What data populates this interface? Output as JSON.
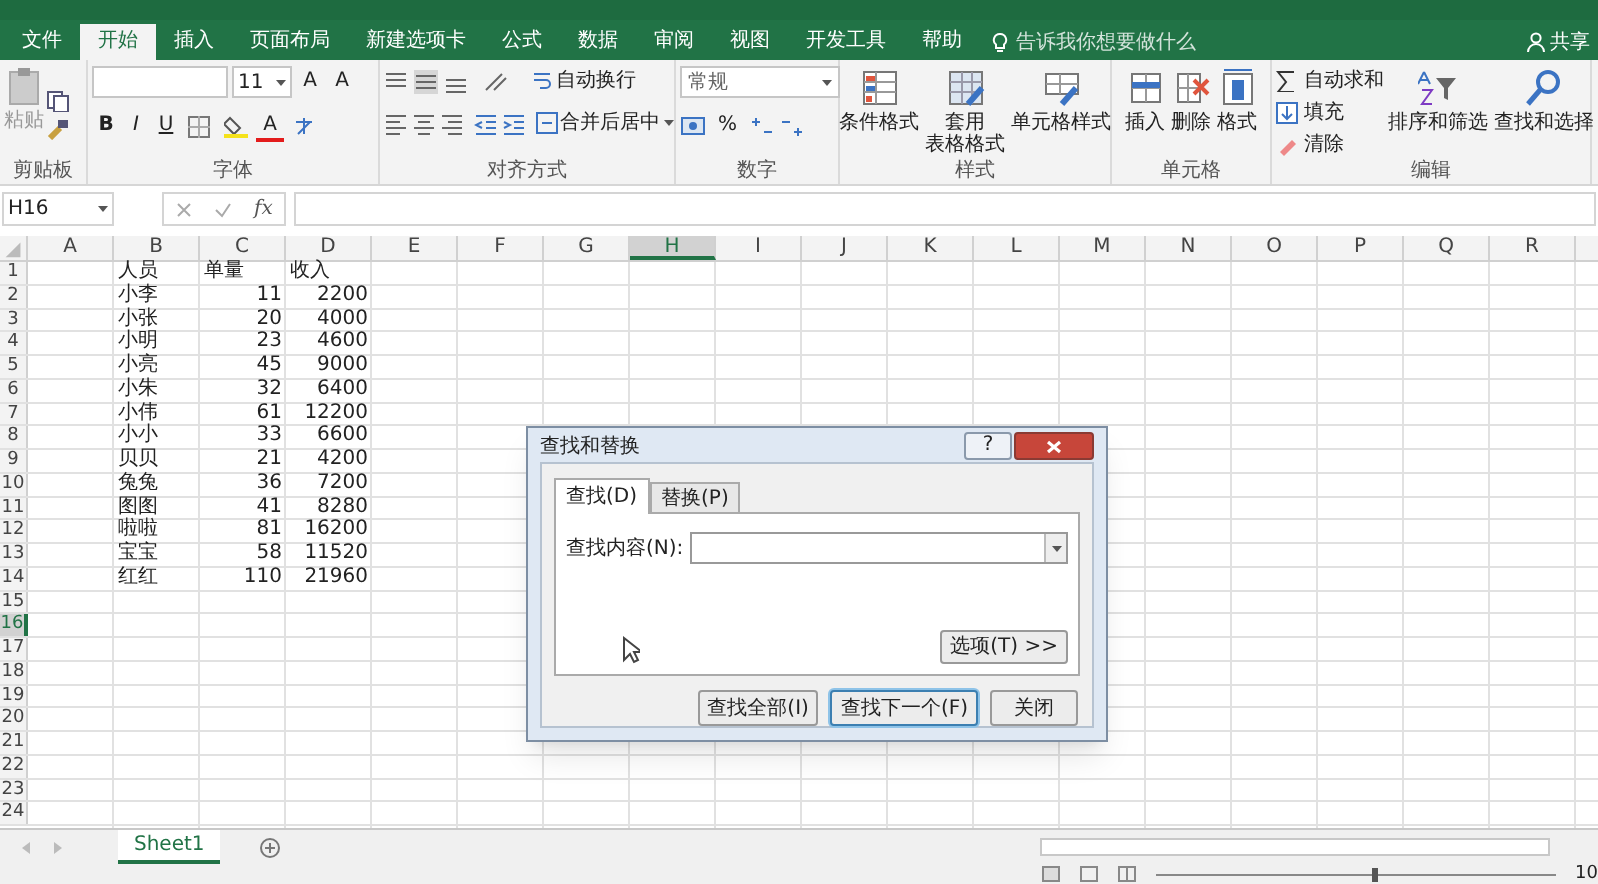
{
  "ribbon_tabs": [
    {
      "label": "文件",
      "selected": false
    },
    {
      "label": "开始",
      "selected": true
    },
    {
      "label": "插入",
      "selected": false
    },
    {
      "label": "页面布局",
      "selected": false
    },
    {
      "label": "新建选项卡",
      "selected": false
    },
    {
      "label": "公式",
      "selected": false
    },
    {
      "label": "数据",
      "selected": false
    },
    {
      "label": "审阅",
      "selected": false
    },
    {
      "label": "视图",
      "selected": false
    },
    {
      "label": "开发工具",
      "selected": false
    },
    {
      "label": "帮助",
      "selected": false
    }
  ],
  "tell_me": "告诉我你想要做什么",
  "share": "共享",
  "ribbon_groups": [
    {
      "kind": "clipboard",
      "label": "剪贴板",
      "paste": "粘贴"
    },
    {
      "kind": "font",
      "label": "字体",
      "font_size": "11",
      "grow": "A",
      "shrink": "A",
      "bold": "B",
      "italic": "I",
      "underline": "U",
      "font_color": "A"
    },
    {
      "kind": "alignment",
      "label": "对齐方式",
      "wrap_text": "自动换行",
      "merge": "合并后居中"
    },
    {
      "kind": "number",
      "label": "数字",
      "format": "常规",
      "percent": "%"
    },
    {
      "kind": "big_buttons",
      "label": "样式",
      "buttons": [
        [
          "条件格式"
        ],
        [
          "套用",
          "表格格式"
        ],
        [
          "单元格样式"
        ]
      ]
    },
    {
      "kind": "big_buttons",
      "label": "单元格",
      "buttons": [
        [
          "插入"
        ],
        [
          "删除"
        ],
        [
          "格式"
        ]
      ]
    },
    {
      "kind": "editing",
      "label": "编辑",
      "small": [
        "自动求和",
        "填充",
        "清除"
      ],
      "buttons": [
        "排序和筛选",
        "查找和选择"
      ]
    }
  ],
  "formula_bar": {
    "name_box": "H16",
    "function_label": "fx"
  },
  "sheet": {
    "columns": [
      {
        "label": "A",
        "selected": false
      },
      {
        "label": "B",
        "selected": false
      },
      {
        "label": "C",
        "selected": false
      },
      {
        "label": "D",
        "selected": false
      },
      {
        "label": "E",
        "selected": false
      },
      {
        "label": "F",
        "selected": false
      },
      {
        "label": "G",
        "selected": false
      },
      {
        "label": "H",
        "selected": true
      },
      {
        "label": "I",
        "selected": false
      },
      {
        "label": "J",
        "selected": false
      },
      {
        "label": "K",
        "selected": false
      },
      {
        "label": "L",
        "selected": false
      },
      {
        "label": "M",
        "selected": false
      },
      {
        "label": "N",
        "selected": false
      },
      {
        "label": "O",
        "selected": false
      },
      {
        "label": "P",
        "selected": false
      },
      {
        "label": "Q",
        "selected": false
      },
      {
        "label": "R",
        "selected": false
      }
    ],
    "rows": [
      {
        "number": "1",
        "selected": false,
        "cells": {
          "B": {
            "text": "人员",
            "kind": "text"
          },
          "C": {
            "text": "单量",
            "kind": "text"
          },
          "D": {
            "text": "收入",
            "kind": "text"
          }
        }
      },
      {
        "number": "2",
        "selected": false,
        "cells": {
          "B": {
            "text": "小李",
            "kind": "text"
          },
          "C": {
            "text": "11",
            "kind": "number"
          },
          "D": {
            "text": "2200",
            "kind": "number"
          }
        }
      },
      {
        "number": "3",
        "selected": false,
        "cells": {
          "B": {
            "text": "小张",
            "kind": "text"
          },
          "C": {
            "text": "20",
            "kind": "number"
          },
          "D": {
            "text": "4000",
            "kind": "number"
          }
        }
      },
      {
        "number": "4",
        "selected": false,
        "cells": {
          "B": {
            "text": "小明",
            "kind": "text"
          },
          "C": {
            "text": "23",
            "kind": "number"
          },
          "D": {
            "text": "4600",
            "kind": "number"
          }
        }
      },
      {
        "number": "5",
        "selected": false,
        "cells": {
          "B": {
            "text": "小亮",
            "kind": "text"
          },
          "C": {
            "text": "45",
            "kind": "number"
          },
          "D": {
            "text": "9000",
            "kind": "number"
          }
        }
      },
      {
        "number": "6",
        "selected": false,
        "cells": {
          "B": {
            "text": "小朱",
            "kind": "text"
          },
          "C": {
            "text": "32",
            "kind": "number"
          },
          "D": {
            "text": "6400",
            "kind": "number"
          }
        }
      },
      {
        "number": "7",
        "selected": false,
        "cells": {
          "B": {
            "text": "小伟",
            "kind": "text"
          },
          "C": {
            "text": "61",
            "kind": "number"
          },
          "D": {
            "text": "12200",
            "kind": "number"
          }
        }
      },
      {
        "number": "8",
        "selected": false,
        "cells": {
          "B": {
            "text": "小小",
            "kind": "text"
          },
          "C": {
            "text": "33",
            "kind": "number"
          },
          "D": {
            "text": "6600",
            "kind": "number"
          }
        }
      },
      {
        "number": "9",
        "selected": false,
        "cells": {
          "B": {
            "text": "贝贝",
            "kind": "text"
          },
          "C": {
            "text": "21",
            "kind": "number"
          },
          "D": {
            "text": "4200",
            "kind": "number"
          }
        }
      },
      {
        "number": "10",
        "selected": false,
        "cells": {
          "B": {
            "text": "兔兔",
            "kind": "text"
          },
          "C": {
            "text": "36",
            "kind": "number"
          },
          "D": {
            "text": "7200",
            "kind": "number"
          }
        }
      },
      {
        "number": "11",
        "selected": false,
        "cells": {
          "B": {
            "text": "图图",
            "kind": "text"
          },
          "C": {
            "text": "41",
            "kind": "number"
          },
          "D": {
            "text": "8280",
            "kind": "number"
          }
        }
      },
      {
        "number": "12",
        "selected": false,
        "cells": {
          "B": {
            "text": "啦啦",
            "kind": "text"
          },
          "C": {
            "text": "81",
            "kind": "number"
          },
          "D": {
            "text": "16200",
            "kind": "number"
          }
        }
      },
      {
        "number": "13",
        "selected": false,
        "cells": {
          "B": {
            "text": "宝宝",
            "kind": "text"
          },
          "C": {
            "text": "58",
            "kind": "number"
          },
          "D": {
            "text": "11520",
            "kind": "number"
          }
        }
      },
      {
        "number": "14",
        "selected": false,
        "cells": {
          "B": {
            "text": "红红",
            "kind": "text"
          },
          "C": {
            "text": "110",
            "kind": "number"
          },
          "D": {
            "text": "21960",
            "kind": "number"
          }
        }
      },
      {
        "number": "15",
        "selected": false
      },
      {
        "number": "16",
        "selected": true
      },
      {
        "number": "17",
        "selected": false
      },
      {
        "number": "18",
        "selected": false
      },
      {
        "number": "19",
        "selected": false
      },
      {
        "number": "20",
        "selected": false
      },
      {
        "number": "21",
        "selected": false
      },
      {
        "number": "22",
        "selected": false
      },
      {
        "number": "23",
        "selected": false
      },
      {
        "number": "24",
        "selected": false
      }
    ]
  },
  "sheet_tabs": [
    {
      "label": "Sheet1",
      "selected": true
    }
  ],
  "status_bar": {
    "zoom_slider": {
      "level": 0.55
    },
    "zoom": "10"
  },
  "dialog": {
    "title": "查找和替换",
    "help": "?",
    "tabs": [
      {
        "label": "查找(D)",
        "selected": true
      },
      {
        "label": "替换(P)",
        "selected": false
      }
    ],
    "find_label": "查找内容(N):",
    "options_button": "选项(T) >>",
    "buttons": [
      {
        "label": "查找全部(I)",
        "default": false
      },
      {
        "label": "查找下一个(F)",
        "default": true
      },
      {
        "label": "关闭",
        "default": false
      }
    ]
  }
}
